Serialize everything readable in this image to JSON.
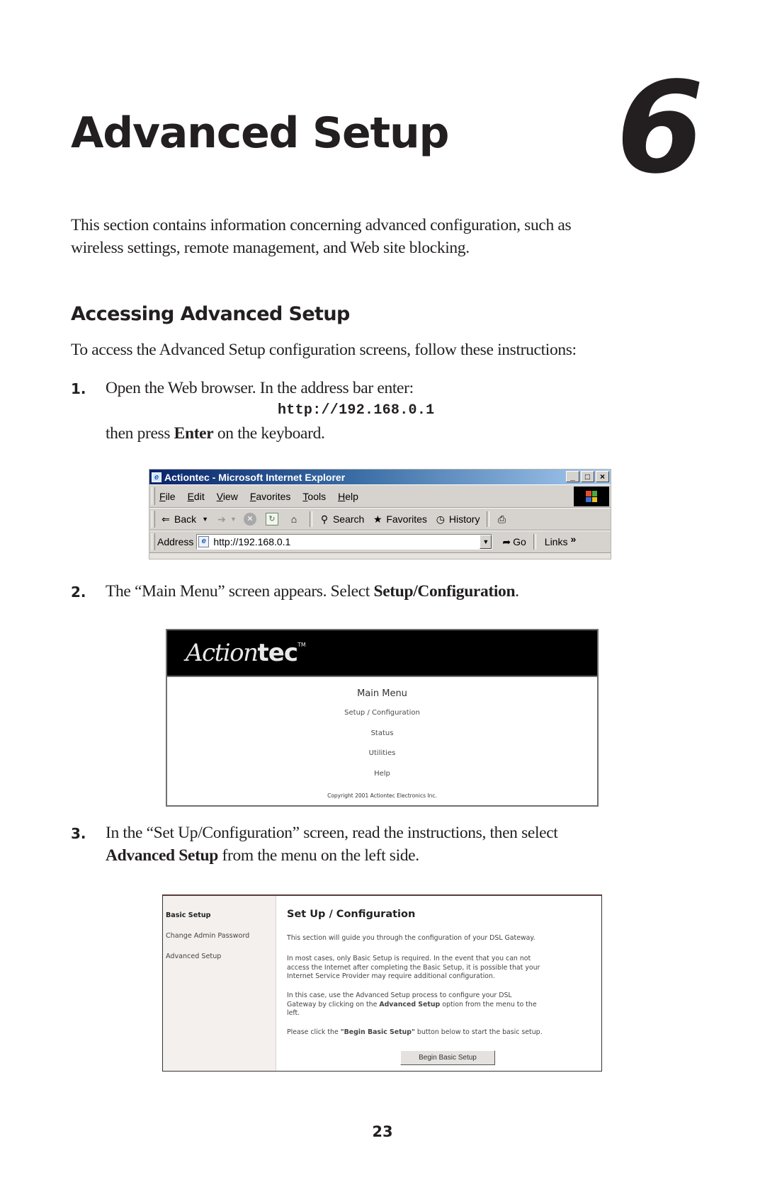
{
  "chapter": {
    "title": "Advanced Setup",
    "number": "6"
  },
  "intro": {
    "lines": [
      "This section contains information concerning advanced configuration, such as",
      "wireless settings, remote management, and Web site blocking."
    ]
  },
  "section": {
    "heading": "Accessing Advanced Setup",
    "intro": "To access the Advanced Setup configuration screens, follow these instructions:"
  },
  "steps": [
    {
      "number": "1.",
      "text": "Open the Web browser. In the address bar enter:",
      "url": "http://192.168.0.1",
      "after_prefix": "then press ",
      "after_bold": "Enter",
      "after_suffix": " on the keyboard."
    },
    {
      "number": "2.",
      "text_prefix": "The “Main Menu” screen appears. Select ",
      "text_bold": "Setup/Configuration",
      "text_suffix": "."
    },
    {
      "number": "3.",
      "line1": "In the “Set Up/Configuration” screen, read the instructions, then select",
      "line2_bold": "Advanced Setup",
      "line2_suffix": " from the menu on the left side."
    }
  ],
  "browser": {
    "title": "Actiontec - Microsoft Internet Explorer",
    "window_buttons": [
      "_",
      "□",
      "×"
    ],
    "menu": [
      "File",
      "Edit",
      "View",
      "Favorites",
      "Tools",
      "Help"
    ],
    "toolbar": {
      "back": "Back",
      "search": "Search",
      "favorites": "Favorites",
      "history": "History"
    },
    "address_label": "Address",
    "address_value": "http://192.168.0.1",
    "go_label": "Go",
    "links_label": "Links",
    "links_chevron": "»"
  },
  "main_menu_screen": {
    "logo_script": "Action",
    "logo_bold": "tec",
    "logo_tm": "TM",
    "title": "Main Menu",
    "links": [
      "Setup / Configuration",
      "Status",
      "Utilities",
      "Help"
    ],
    "copyright": "Copyright 2001 Actiontec Electronics Inc."
  },
  "setup_screen": {
    "sidebar": [
      "Basic Setup",
      "Change Admin Password",
      "Advanced Setup"
    ],
    "title": "Set Up / Configuration",
    "p1": "This section will guide you through the configuration of your DSL Gateway.",
    "p2_lines": [
      "In most cases, only Basic Setup is required. In the event that you can not",
      "access the Internet after completing the Basic Setup, it is possible that your",
      "Internet Service Provider may require additional configuration."
    ],
    "p3_line1": "In this case, use the Advanced Setup process to configure your DSL",
    "p3_line2_prefix": "Gateway by clicking on the ",
    "p3_line2_bold": "Advanced Setup",
    "p3_line2_suffix": " option from the menu to the",
    "p3_line3": "left.",
    "p4_prefix": "Please click the ",
    "p4_bold": "\"Begin Basic Setup\"",
    "p4_suffix": " button below to start the basic setup.",
    "button_label": "Begin Basic Setup"
  },
  "page_number": "23"
}
